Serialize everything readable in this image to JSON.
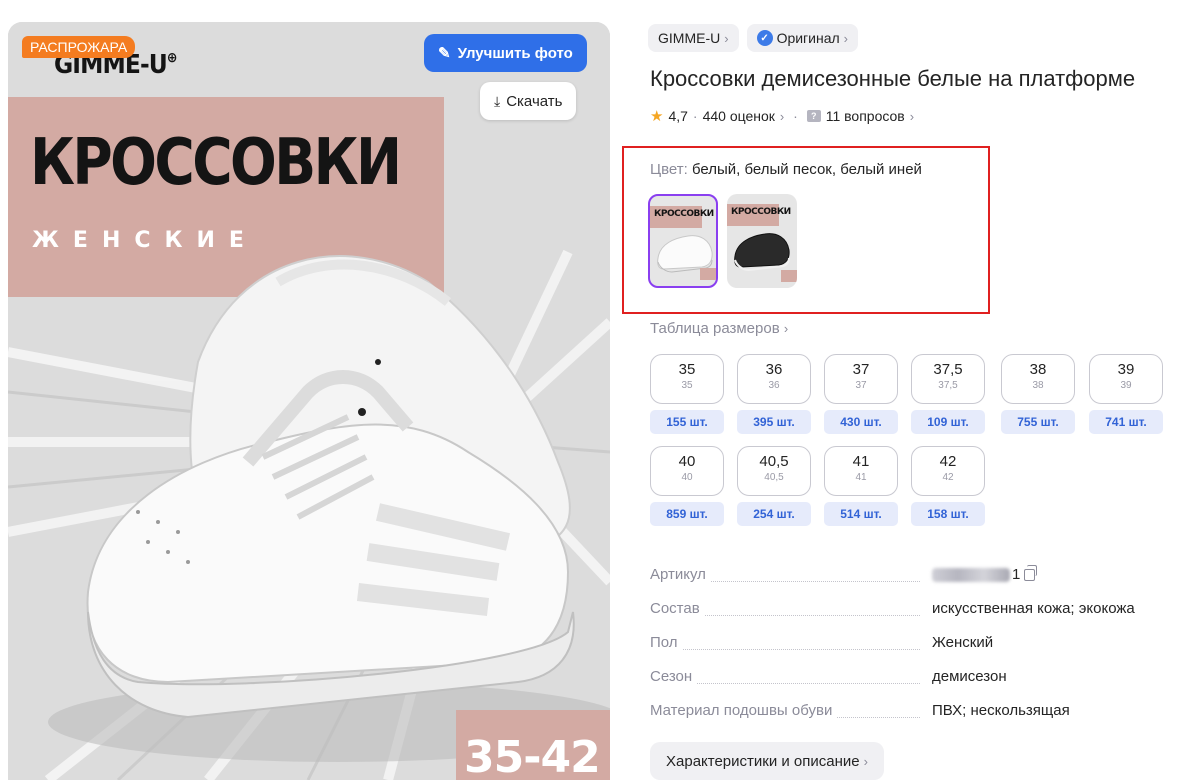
{
  "hero": {
    "sale_badge": "РАСПРОЖАРА",
    "brand_logo": "GIMME-U",
    "logo_mark": "⊕",
    "headline": "КРОССОВКИ",
    "subhead": "ЖЕНСКИЕ",
    "size_range": "35-42",
    "improve_button": "Улучшить фото",
    "download_button": "Скачать",
    "pink_color": "#d3aaa3",
    "accent_blue": "#2f6fe8",
    "badge_orange": "#f47c20"
  },
  "chips": [
    {
      "label": "GIMME-U",
      "icon": "none"
    },
    {
      "label": "Оригинал",
      "icon": "verified-check-icon"
    }
  ],
  "product": {
    "title": "Кроссовки демисезонные белые на платформе",
    "rating": "4,7",
    "ratings_count": "440 оценок",
    "questions": "11 вопросов"
  },
  "color_selector": {
    "label_key": "Цвет:",
    "label_value": "белый, белый песок, белый иней",
    "thumbs": [
      {
        "caption": "КРОССОВКИ",
        "shoe": "white",
        "selected": true
      },
      {
        "caption": "КРОССОВКИ",
        "shoe": "black",
        "selected": false
      }
    ],
    "highlight_color": "#e02020",
    "selected_color": "#8a3ff0"
  },
  "sizes": {
    "table_link": "Таблица размеров",
    "items": [
      {
        "size": "35",
        "ru": "35",
        "stock": "155 шт."
      },
      {
        "size": "36",
        "ru": "36",
        "stock": "395 шт."
      },
      {
        "size": "37",
        "ru": "37",
        "stock": "430 шт."
      },
      {
        "size": "37,5",
        "ru": "37,5",
        "stock": "109 шт."
      },
      {
        "size": "38",
        "ru": "38",
        "stock": "755 шт."
      },
      {
        "size": "39",
        "ru": "39",
        "stock": "741 шт."
      },
      {
        "size": "40",
        "ru": "40",
        "stock": "859 шт."
      },
      {
        "size": "40,5",
        "ru": "40,5",
        "stock": "254 шт."
      },
      {
        "size": "41",
        "ru": "41",
        "stock": "514 шт."
      },
      {
        "size": "42",
        "ru": "42",
        "stock": "158 шт."
      }
    ]
  },
  "specs": [
    {
      "key": "Артикул",
      "value": "1"
    },
    {
      "key": "Состав",
      "value": "искусственная кожа; экокожа"
    },
    {
      "key": "Пол",
      "value": "Женский"
    },
    {
      "key": "Сезон",
      "value": "демисезон"
    },
    {
      "key": "Материал подошвы обуви",
      "value": "ПВХ; нескользящая"
    }
  ],
  "description_button": "Характеристики и описание"
}
